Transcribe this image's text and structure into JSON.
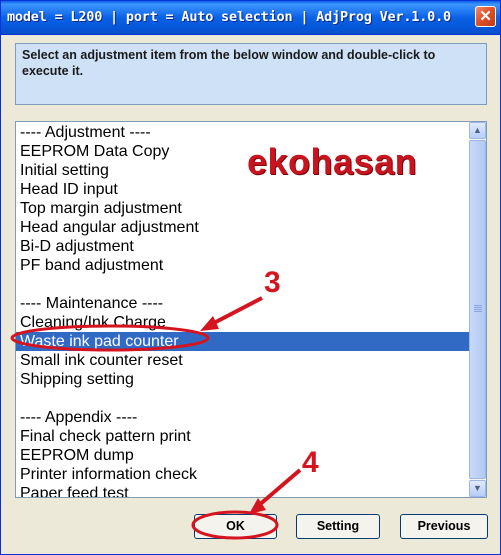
{
  "window": {
    "title": "model = L200 | port = Auto selection | AdjProg Ver.1.0.0",
    "close_symbol": "✕"
  },
  "instructions": {
    "text": "Select an adjustment item from the below window and double-click to execute it."
  },
  "list": {
    "items": [
      "---- Adjustment ----",
      "EEPROM Data Copy",
      "Initial setting",
      "Head ID input",
      "Top margin adjustment",
      "Head angular adjustment",
      "Bi-D adjustment",
      "PF band adjustment",
      "",
      "---- Maintenance ----",
      "Cleaning/Ink Charge",
      "Waste ink pad counter",
      "Small ink counter reset",
      "Shipping setting",
      "",
      "---- Appendix ----",
      "Final check pattern print",
      "EEPROM dump",
      "Printer information check",
      "Paper feed test"
    ],
    "selected_index": 11
  },
  "scrollbar": {
    "up_icon": "up-arrow-icon",
    "down_icon": "down-arrow-icon"
  },
  "buttons": {
    "ok": "OK",
    "setting": "Setting",
    "previous": "Previous"
  },
  "watermark": "ekohasan",
  "annotations": {
    "step3": "3",
    "step4": "4",
    "color": "#d4141e"
  },
  "colors": {
    "selection": "#316ac5",
    "titlebar": "#0a62e6",
    "instruction_bg": "#cfe1f7"
  }
}
